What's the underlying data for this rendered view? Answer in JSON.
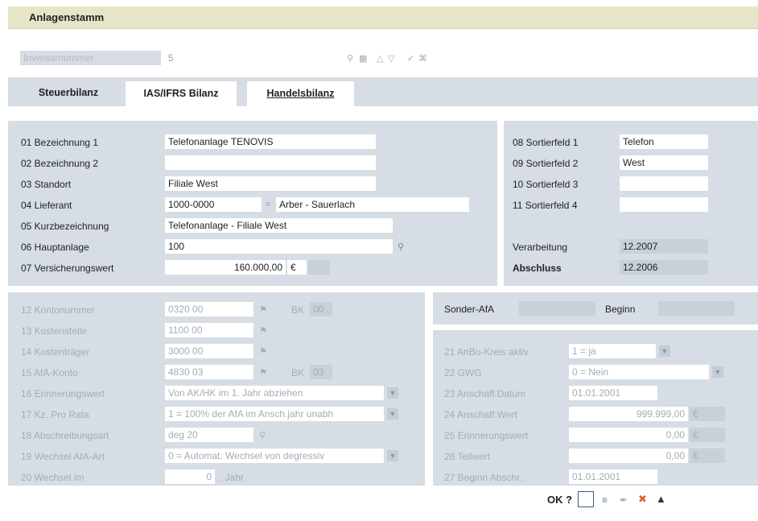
{
  "title": "Anlagenstamm",
  "header": {
    "inventar_label": "Inventarnummer",
    "inventar_value": "5"
  },
  "tabs": [
    {
      "label": "Steuerbilanz",
      "active": true
    },
    {
      "label": "IAS/IFRS Bilanz",
      "active": false
    },
    {
      "label": "Handelsbilanz",
      "active": false
    }
  ],
  "main": {
    "r01_label": "01 Bezeichnung 1",
    "r01_value": "Telefonanlage TENOVIS",
    "r02_label": "02 Bezeichnung 2",
    "r02_value": "",
    "r03_label": "03 Standort",
    "r03_value": "Filiale West",
    "r04_label": "04 Lieferant",
    "r04_value": "1000-0000",
    "r04_sep": "=",
    "r04_name": "Arber - Sauerlach",
    "r05_label": "05 Kurzbezeichnung",
    "r05_value": "Telefonanlage  - Filiale West",
    "r06_label": "06 Hauptanlage",
    "r06_value": "100",
    "r07_label": "07 Versicherungswert",
    "r07_value": "160.000,00",
    "r07_currency": "€"
  },
  "right": {
    "r08_label": "08 Sortierfeld 1",
    "r08_value": "Telefon",
    "r09_label": "09 Sortierfeld 2",
    "r09_value": "West",
    "r10_label": "10 Sortierfeld 3",
    "r10_value": "",
    "r11_label": "11 Sortierfeld 4",
    "r11_value": "",
    "verarbeitung_label": "Verarbeitung",
    "verarbeitung_value": "12.2007",
    "abschluss_label": "Abschluss",
    "abschluss_value": "12.2006"
  },
  "lower_left": {
    "r12_label": "12 Kontonummer",
    "r12_value": "0320  00",
    "r12_bk_label": "BK",
    "r12_bk_value": "00",
    "r13_label": "13 Kostenstelle",
    "r13_value": "1100  00",
    "r14_label": "14 Kostenträger",
    "r14_value": "3000  00",
    "r15_label": "15 AfA-Konto",
    "r15_value": "4830  03",
    "r15_bk_label": "BK",
    "r15_bk_value": "03",
    "r16_label": "16 Erinnerungswert",
    "r16_value": "Von AK/HK im 1. Jahr abziehen",
    "r17_label": "17 Kz. Pro Rata",
    "r17_value": "1 = 100% der AfA im Ansch.jahr unabh",
    "r18_label": "18 Abschreibungsart",
    "r18_value": "deg 20",
    "r19_label": "19 Wechsel AfA-Art",
    "r19_value": "0 = Automat. Wechsel von degressiv",
    "r20_label": "20 Wechsel im",
    "r20_value": "0",
    "r20_suffix": ". Jahr"
  },
  "sonder": {
    "label": "Sonder-AfA",
    "beginn_label": "Beginn"
  },
  "lower_right": {
    "r21_label": "21 AnBu-Kreis aktiv",
    "r21_value": "1 = ja",
    "r22_label": "22 GWG",
    "r22_value": "0 = Nein",
    "r23_label": "23 Anschaff.Datum",
    "r23_value": "01.01.2001",
    "r24_label": "24 Anschaff.Wert",
    "r24_value": "999.999,00",
    "r24_currency": "€",
    "r25_label": "25 Erinnerungswert",
    "r25_value": "0,00",
    "r25_currency": "€",
    "r26_label": "26 Teilwert",
    "r26_value": "0,00",
    "r26_currency": "€",
    "r27_label": "27 Beginn Abschr.",
    "r27_value": "01.01.2001"
  },
  "footer": {
    "ok_label": "OK ?"
  },
  "icons": [
    "search-icon",
    "save-icon",
    "up-icon",
    "down-icon",
    "edit-icon",
    "settings-icon",
    "lookup-icon",
    "dropdown-icon",
    "check-icon",
    "pencil-icon",
    "delete-icon",
    "trash-icon"
  ],
  "colors": {
    "panel": "#d6dde4",
    "title_bar": "#e6e5c8",
    "ok_box": "#3a5a8a",
    "delete": "#e06040"
  }
}
